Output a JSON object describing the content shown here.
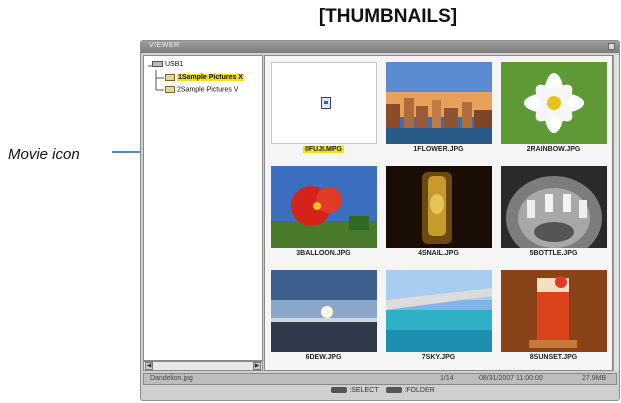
{
  "heading": "[THUMBNAILS]",
  "callout": {
    "label": "Movie icon"
  },
  "window": {
    "title": "VIEWER"
  },
  "tree": {
    "root": "USB1",
    "folders": [
      "1Sample Pictures X",
      "2Sample Pictures V"
    ]
  },
  "thumbnails": [
    {
      "name": "0FUJI.MPG",
      "kind": "movie",
      "selected": true
    },
    {
      "name": "1FLOWER.JPG"
    },
    {
      "name": "2RAINBOW.JPG"
    },
    {
      "name": "3BALLOON.JPG"
    },
    {
      "name": "4SNAIL.JPG"
    },
    {
      "name": "5BOTTLE.JPG"
    },
    {
      "name": "6DEW.JPG"
    },
    {
      "name": "7SKY.JPG"
    },
    {
      "name": "8SUNSET.JPG"
    }
  ],
  "status": {
    "filename": "Dandelion.jpg",
    "position": "1/14",
    "datetime": "08/31/2007 11:00:00",
    "size": "27.9MB"
  },
  "hints": {
    "select": ":SELECT",
    "folder": ":FOLDER"
  },
  "colors": {
    "highlight": "#f2e11a",
    "callout_line": "#1f63a8"
  }
}
